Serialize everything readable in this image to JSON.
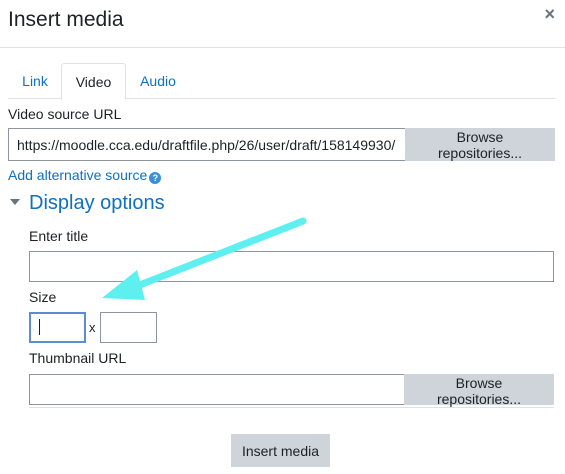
{
  "dialog": {
    "title": "Insert media",
    "close_symbol": "×"
  },
  "tabs": [
    {
      "label": "Link",
      "active": false
    },
    {
      "label": "Video",
      "active": true
    },
    {
      "label": "Audio",
      "active": false
    }
  ],
  "video_source": {
    "label": "Video source URL",
    "value": "https://moodle.cca.edu/draftfile.php/26/user/draft/158149930/",
    "browse_label": "Browse repositories..."
  },
  "alternative_source": {
    "link_text": "Add alternative source",
    "help_icon": "help-circle-icon"
  },
  "display_options": {
    "heading": "Display options",
    "expanded": true,
    "title_label": "Enter title",
    "title_value": "",
    "size_label": "Size",
    "width_value": "",
    "height_value": "",
    "size_separator": "x",
    "thumbnail_label": "Thumbnail URL",
    "thumbnail_value": "",
    "thumbnail_browse_label": "Browse repositories..."
  },
  "footer": {
    "insert_label": "Insert media"
  },
  "colors": {
    "link": "#0f6fc5",
    "button_bg": "#ced4da",
    "annotation_arrow": "#5ef0f0"
  }
}
